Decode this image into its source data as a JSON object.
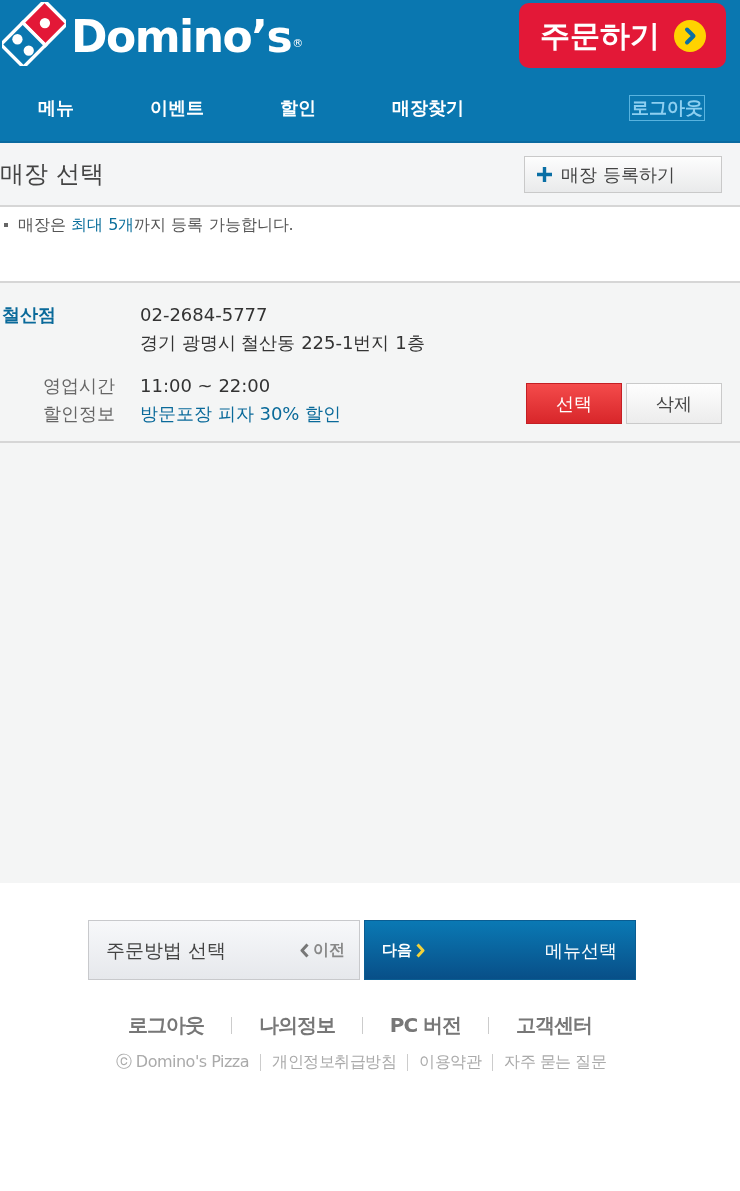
{
  "header": {
    "brand": {
      "wordmark": "Domino’s",
      "trademark": "®"
    },
    "order_button": {
      "label": "주문하기"
    },
    "nav": [
      {
        "label": "메뉴"
      },
      {
        "label": "이벤트"
      },
      {
        "label": "할인"
      },
      {
        "label": "매장찾기"
      }
    ],
    "logout": {
      "label": "로그아웃"
    }
  },
  "section": {
    "title": "매장 선택",
    "add_button": {
      "label": "매장 등록하기"
    }
  },
  "notice": "매장은 **최대 5개**까지 등록 가능합니다.",
  "stores": [
    {
      "name": "철산점",
      "phone": "02-2684-5777",
      "address": "경기 광명시 철산동 225-1번지 1층",
      "details": [
        {
          "label": "영업시간",
          "value": "11:00 ~ 22:00",
          "kind": "plain"
        },
        {
          "label": "할인정보",
          "value": "방문포장 피자 30% 할인",
          "kind": "highlight"
        }
      ],
      "buttons": [
        {
          "label": "선택",
          "kind": "primary"
        },
        {
          "label": "삭제",
          "kind": "secondary"
        }
      ]
    }
  ],
  "step_nav": {
    "prev": {
      "title": "주문방법 선택",
      "label": "이전"
    },
    "next": {
      "label": "다음",
      "title": "메뉴선택"
    }
  },
  "footer": {
    "links": [
      "로그아웃",
      "나의정보",
      "PC 버전",
      "고객센터"
    ],
    "legal": [
      "ⓒ Domino's Pizza",
      "개인정보취급방침",
      "이용약관",
      "자주 묻는 질문"
    ]
  }
}
